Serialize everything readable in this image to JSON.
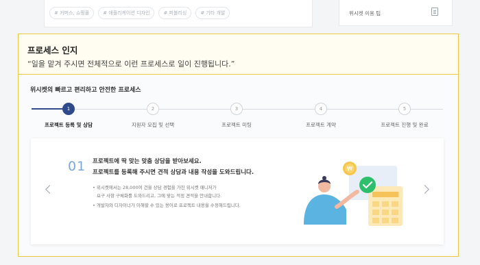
{
  "top_card": {
    "tags": [
      "# 커머스, 쇼핑몰",
      "# 애플리케이션 디자인",
      "# 퍼블리싱",
      "# 기타 개발"
    ]
  },
  "right_card": {
    "tip_label": "위시켓 이용 팁"
  },
  "header": {
    "title": "프로세스 인지",
    "quote": "“일을 맡겨 주시면 전체적으로 이런 프로세스로 일이 진행됩니다.”"
  },
  "process": {
    "title": "위시켓의 빠르고 편리하고 안전한 프로세스",
    "active_index": 0,
    "steps": [
      {
        "number": "1",
        "label": "프로젝트 등록 및 상담"
      },
      {
        "number": "2",
        "label": "지원자 모집 및 선택"
      },
      {
        "number": "3",
        "label": "프로젝트 미팅"
      },
      {
        "number": "4",
        "label": "프로젝트 계약"
      },
      {
        "number": "5",
        "label": "프로젝트 진행 및 완료"
      }
    ]
  },
  "panel": {
    "step_number": "01",
    "heading_line1": "프로젝트에 딱 맞는 맞춤 상담을 받아보세요.",
    "heading_line2": "프로젝트를 등록해 주시면 견적 상담과 내용 작성을 도와드립니다.",
    "bullet1_line1": "•  위시켓에서는 28,000여 건을 상담 경험을 가진 위시켓 매니저가",
    "bullet1_line2": "요구 사항 구체화를 도와드리고, 그에 맞는 적정 견적을 안내합니다.",
    "bullet2": "•  개발자와 디자이너가 이해할 수 있는 용어로 프로젝트 내용을 수정해드립니다."
  },
  "colors": {
    "accent": "#2f4a8a",
    "highlight_border": "#f0c542",
    "header_bg": "#fffcf1",
    "step_number": "#7aa7d8"
  },
  "icons": {
    "right_card_icon": "document-icon",
    "prev": "chevron-left-icon",
    "next": "chevron-right-icon"
  }
}
